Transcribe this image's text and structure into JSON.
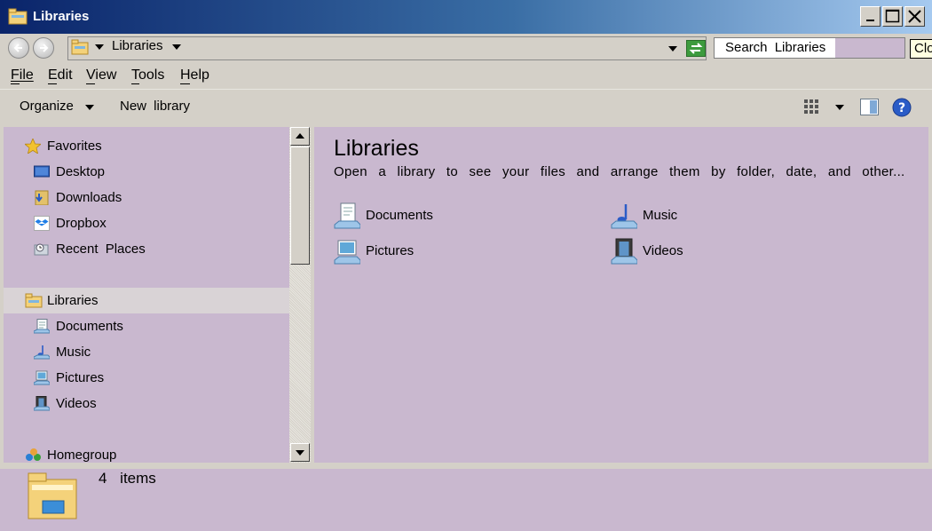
{
  "window": {
    "title": "Libraries"
  },
  "address": {
    "breadcrumb": "Libraries"
  },
  "search": {
    "placeholder": "Search  Libraries"
  },
  "tooltip": {
    "text": "Clo"
  },
  "menu": {
    "file": "File",
    "edit": "Edit",
    "view": "View",
    "tools": "Tools",
    "help": "Help"
  },
  "toolbar": {
    "organize": "Organize",
    "new_library": "New  library"
  },
  "nav": {
    "items": [
      {
        "label": "Favorites",
        "icon": "star-icon"
      },
      {
        "label": "Desktop",
        "icon": "desktop-icon"
      },
      {
        "label": "Downloads",
        "icon": "downloads-icon"
      },
      {
        "label": "Dropbox",
        "icon": "dropbox-icon"
      },
      {
        "label": "Recent  Places",
        "icon": "recent-places-icon"
      },
      {
        "label": "Libraries",
        "icon": "libraries-icon"
      },
      {
        "label": "Documents",
        "icon": "documents-icon"
      },
      {
        "label": "Music",
        "icon": "music-icon"
      },
      {
        "label": "Pictures",
        "icon": "pictures-icon"
      },
      {
        "label": "Videos",
        "icon": "videos-icon"
      },
      {
        "label": "Homegroup",
        "icon": "homegroup-icon"
      }
    ]
  },
  "content": {
    "title": "Libraries",
    "description": "Open a library to see your files and arrange them by folder, date, and other...",
    "libraries": [
      {
        "label": "Documents",
        "icon": "documents-icon"
      },
      {
        "label": "Music",
        "icon": "music-icon"
      },
      {
        "label": "Pictures",
        "icon": "pictures-icon"
      },
      {
        "label": "Videos",
        "icon": "videos-icon"
      }
    ]
  },
  "status": {
    "count_text": "4  items"
  },
  "colors": {
    "pane_bg": "#c9b8cf",
    "chrome_bg": "#d4d0c8",
    "title_start": "#0a246a",
    "title_end": "#a6caf0"
  }
}
